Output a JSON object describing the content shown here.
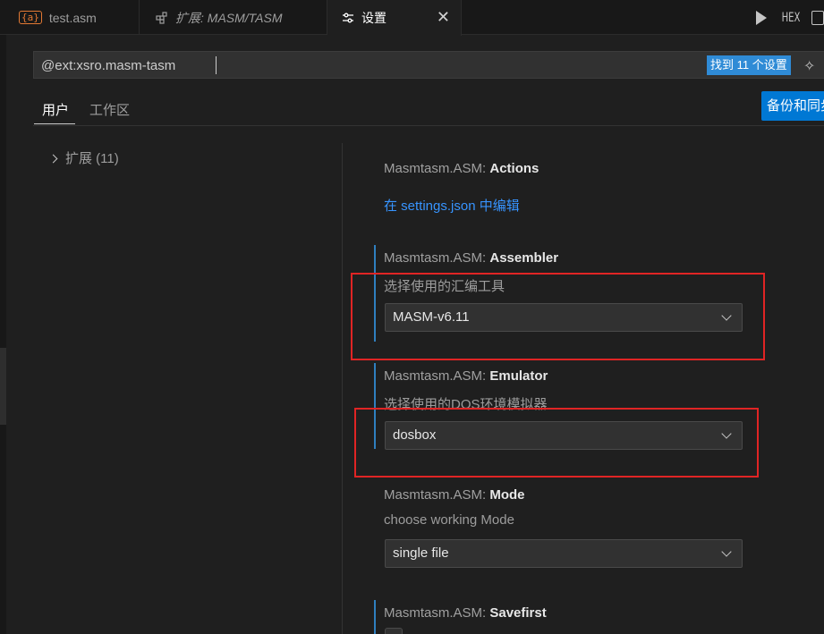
{
  "tabs": [
    {
      "label": "test.asm",
      "icon": "asm-file-icon",
      "icon_text": "{a}"
    },
    {
      "label": "扩展: MASM/TASM",
      "icon": "extensions-icon"
    },
    {
      "label": "设置",
      "icon": "settings-icon",
      "close": "✕"
    }
  ],
  "toolbar": {
    "hex_label": "HEX"
  },
  "search": {
    "value": "@ext:xsro.masm-tasm",
    "result_count": "找到 11 个设置"
  },
  "scopes": {
    "user": "用户",
    "workspace": "工作区"
  },
  "sync_button": "备份和同步设置",
  "toc": {
    "extensions_label": "扩展 (11)"
  },
  "settings": [
    {
      "prefix": "Masmtasm.ASM: ",
      "name": "Actions",
      "link": "在 settings.json 中编辑"
    },
    {
      "prefix": "Masmtasm.ASM: ",
      "name": "Assembler",
      "description": "选择使用的汇编工具",
      "value": "MASM-v6.11"
    },
    {
      "prefix": "Masmtasm.ASM: ",
      "name": "Emulator",
      "description": "选择使用的DOS环境模拟器",
      "value": "dosbox"
    },
    {
      "prefix": "Masmtasm.ASM: ",
      "name": "Mode",
      "description": "choose working Mode",
      "value": "single file"
    },
    {
      "prefix": "Masmtasm.ASM: ",
      "name": "Savefirst"
    }
  ],
  "colors": {
    "accent": "#0078d4",
    "modified_bar": "#2f7fbf",
    "annotation_red": "#e02424",
    "link": "#3794ff"
  }
}
